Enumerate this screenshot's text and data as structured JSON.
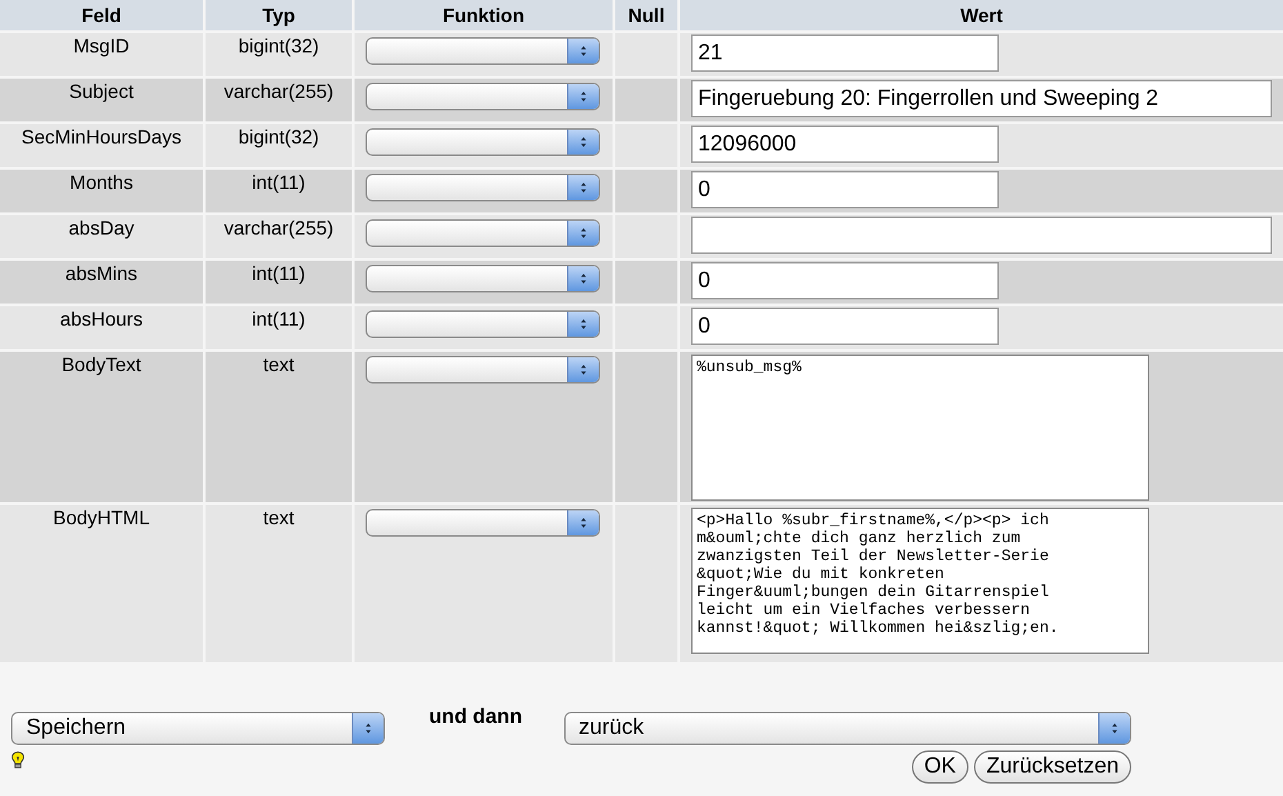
{
  "table": {
    "columns": [
      "Feld",
      "Typ",
      "Funktion",
      "Null",
      "Wert"
    ],
    "rows": [
      {
        "field": "MsgID",
        "type": "bigint(32)",
        "kind": "short-input",
        "value": "21"
      },
      {
        "field": "Subject",
        "type": "varchar(255)",
        "kind": "long-input",
        "value": "Fingeruebung 20: Fingerrollen und Sweeping 2"
      },
      {
        "field": "SecMinHoursDays",
        "type": "bigint(32)",
        "kind": "short-input",
        "value": "12096000"
      },
      {
        "field": "Months",
        "type": "int(11)",
        "kind": "short-input",
        "value": "0"
      },
      {
        "field": "absDay",
        "type": "varchar(255)",
        "kind": "long-input"
      },
      {
        "field": "absMins",
        "type": "int(11)",
        "kind": "short-input",
        "value": "0"
      },
      {
        "field": "absHours",
        "type": "int(11)",
        "kind": "short-input",
        "value": "0"
      },
      {
        "field": "BodyText",
        "type": "text",
        "kind": "textarea",
        "value": "%unsub_msg%"
      },
      {
        "field": "BodyHTML",
        "type": "text",
        "kind": "scroll-textarea",
        "value": "<p>Hallo %subr_firstname%,</p><p> ich\nm&ouml;chte dich ganz herzlich zum\nzwanzigsten Teil der Newsletter-Serie\n&quot;Wie du mit konkreten\nFinger&uuml;bungen dein Gitarrenspiel\nleicht um ein Vielfaches verbessern\nkannst!&quot; Willkommen hei&szlig;en."
      }
    ]
  },
  "footer": {
    "action": "Speichern",
    "connector": "und dann",
    "after": "zurück",
    "buttons": [
      "OK",
      "Zurücksetzen"
    ]
  }
}
